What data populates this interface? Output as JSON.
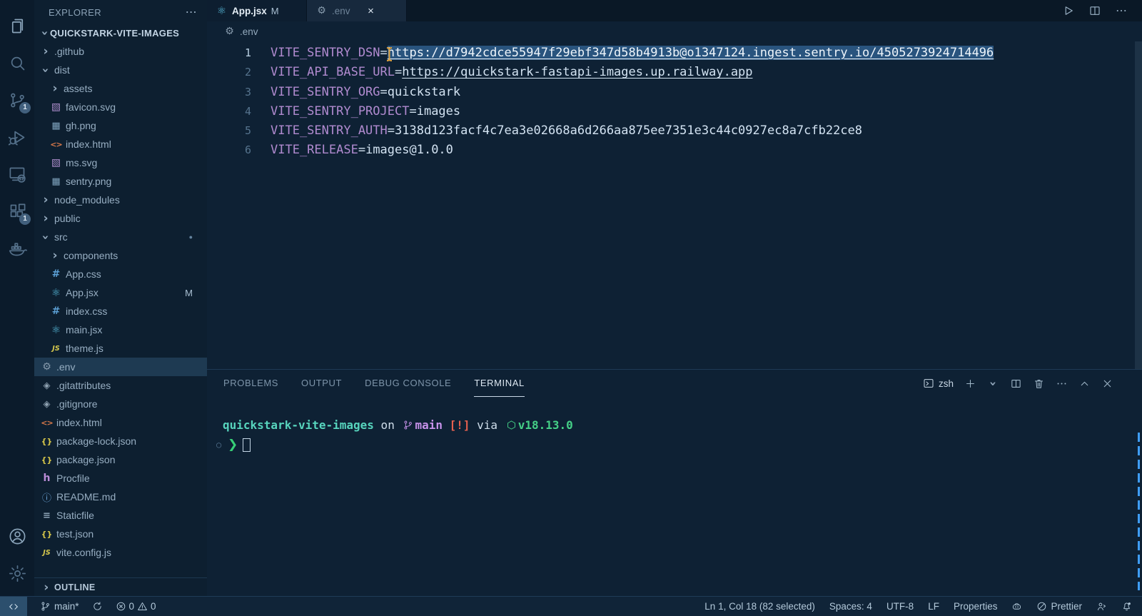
{
  "activity_bar": {
    "items": [
      {
        "name": "explorer",
        "icon": "files-icon"
      },
      {
        "name": "search",
        "icon": "search-icon"
      },
      {
        "name": "source-control",
        "icon": "source-control-icon",
        "badge": "1"
      },
      {
        "name": "run-debug",
        "icon": "run-debug-icon"
      },
      {
        "name": "remote-explorer",
        "icon": "remote-explorer-icon"
      },
      {
        "name": "extensions",
        "icon": "extensions-icon",
        "badge": "1"
      },
      {
        "name": "docker",
        "icon": "docker-icon"
      }
    ],
    "bottom_items": [
      {
        "name": "account",
        "icon": "account-icon"
      },
      {
        "name": "settings",
        "icon": "gear-icon"
      }
    ]
  },
  "sidebar": {
    "title": "EXPLORER",
    "section": "QUICKSTARK-VITE-IMAGES",
    "outline_label": "OUTLINE",
    "tree": [
      {
        "label": ".github",
        "indent": 1,
        "icon": "chevron-right-icon"
      },
      {
        "label": "dist",
        "indent": 1,
        "icon": "chevron-down-icon"
      },
      {
        "label": "assets",
        "indent": 2,
        "icon": "chevron-right-icon"
      },
      {
        "label": "favicon.svg",
        "indent": 2,
        "icon": "svg-file-icon"
      },
      {
        "label": "gh.png",
        "indent": 2,
        "icon": "image-file-icon"
      },
      {
        "label": "index.html",
        "indent": 2,
        "icon": "html-file-icon"
      },
      {
        "label": "ms.svg",
        "indent": 2,
        "icon": "svg-file-icon"
      },
      {
        "label": "sentry.png",
        "indent": 2,
        "icon": "image-file-icon"
      },
      {
        "label": "node_modules",
        "indent": 1,
        "icon": "chevron-right-icon"
      },
      {
        "label": "public",
        "indent": 1,
        "icon": "chevron-right-icon"
      },
      {
        "label": "src",
        "indent": 1,
        "icon": "chevron-down-icon",
        "dot": true
      },
      {
        "label": "components",
        "indent": 2,
        "icon": "chevron-right-icon"
      },
      {
        "label": "App.css",
        "indent": 2,
        "icon": "css-file-icon"
      },
      {
        "label": "App.jsx",
        "indent": 2,
        "icon": "react-file-icon",
        "badge": "M"
      },
      {
        "label": "index.css",
        "indent": 2,
        "icon": "css-file-icon"
      },
      {
        "label": "main.jsx",
        "indent": 2,
        "icon": "react-file-icon"
      },
      {
        "label": "theme.js",
        "indent": 2,
        "icon": "js-file-icon"
      },
      {
        "label": ".env",
        "indent": 1,
        "icon": "gear-file-icon",
        "selected": true
      },
      {
        "label": ".gitattributes",
        "indent": 1,
        "icon": "git-file-icon"
      },
      {
        "label": ".gitignore",
        "indent": 1,
        "icon": "git-file-icon"
      },
      {
        "label": "index.html",
        "indent": 1,
        "icon": "html-file-icon"
      },
      {
        "label": "package-lock.json",
        "indent": 1,
        "icon": "json-file-icon"
      },
      {
        "label": "package.json",
        "indent": 1,
        "icon": "json-file-icon"
      },
      {
        "label": "Procfile",
        "indent": 1,
        "icon": "heroku-file-icon"
      },
      {
        "label": "README.md",
        "indent": 1,
        "icon": "info-file-icon"
      },
      {
        "label": "Staticfile",
        "indent": 1,
        "icon": "text-file-icon"
      },
      {
        "label": "test.json",
        "indent": 1,
        "icon": "json-file-icon"
      },
      {
        "label": "vite.config.js",
        "indent": 1,
        "icon": "js-file-icon"
      }
    ]
  },
  "editor": {
    "tabs": [
      {
        "label": "App.jsx",
        "icon": "react-file-icon",
        "badge": "M",
        "active": false
      },
      {
        "label": ".env",
        "icon": "gear-file-icon",
        "active": true,
        "close": true
      }
    ],
    "actions": [
      {
        "name": "run",
        "icon": "play-icon"
      },
      {
        "name": "split-editor",
        "icon": "split-icon"
      },
      {
        "name": "more-actions",
        "icon": "ellipsis-icon"
      }
    ],
    "breadcrumb": {
      "icon": "gear-file-icon",
      "label": ".env"
    },
    "lines": [
      {
        "num": "1",
        "key": "VITE_SENTRY_DSN",
        "value": "https://d7942cdce55947f29ebf347d58b4913b@o1347124.ingest.sentry.io/4505273924714496",
        "link": true,
        "selected": true,
        "active": true
      },
      {
        "num": "2",
        "key": "VITE_API_BASE_URL",
        "value": "https://quickstark-fastapi-images.up.railway.app",
        "link": true
      },
      {
        "num": "3",
        "key": "VITE_SENTRY_ORG",
        "value": "quickstark"
      },
      {
        "num": "4",
        "key": "VITE_SENTRY_PROJECT",
        "value": "images"
      },
      {
        "num": "5",
        "key": "VITE_SENTRY_AUTH",
        "value": "3138d123facf4c7ea3e02668a6d266aa875ee7351e3c44c0927ec8a7cfb22ce8"
      },
      {
        "num": "6",
        "key": "VITE_RELEASE",
        "value": "images@1.0.0"
      }
    ]
  },
  "panel": {
    "tabs": [
      {
        "label": "PROBLEMS"
      },
      {
        "label": "OUTPUT"
      },
      {
        "label": "DEBUG CONSOLE"
      },
      {
        "label": "TERMINAL",
        "active": true
      }
    ],
    "shell_label": "zsh",
    "actions": [
      {
        "name": "new-terminal",
        "icon": "plus-icon"
      },
      {
        "name": "terminal-dropdown",
        "icon": "chevron-down-icon"
      },
      {
        "name": "split-terminal",
        "icon": "split-icon"
      },
      {
        "name": "kill-terminal",
        "icon": "trash-icon"
      },
      {
        "name": "more-actions",
        "icon": "ellipsis-icon"
      },
      {
        "name": "maximize-panel",
        "icon": "chevron-up-icon"
      },
      {
        "name": "close-panel",
        "icon": "close-icon"
      }
    ],
    "terminal": {
      "prompt_segments": [
        {
          "text": "quickstark-vite-images",
          "style": "dir"
        },
        {
          "text": " on ",
          "style": "plain"
        },
        {
          "icon": "branch-icon",
          "style": "branch"
        },
        {
          "text": "main",
          "style": "branch"
        },
        {
          "text": " [!]",
          "style": "alert"
        },
        {
          "text": " via ",
          "style": "plain"
        },
        {
          "icon": "node-icon",
          "style": "node"
        },
        {
          "text": "v18.13.0",
          "style": "node"
        }
      ],
      "job_indicator": "○",
      "prompt_char": "❯"
    }
  },
  "status_bar": {
    "left": [
      {
        "name": "remote",
        "icon": "remote-icon"
      },
      {
        "name": "branch",
        "icon": "branch-icon",
        "label": "main*"
      },
      {
        "name": "sync",
        "icon": "sync-icon"
      },
      {
        "name": "problems",
        "parts": [
          {
            "icon": "error-icon",
            "label": "0"
          },
          {
            "icon": "warning-icon",
            "label": "0"
          }
        ]
      }
    ],
    "right": [
      {
        "name": "cursor-position",
        "label": "Ln 1, Col 18 (82 selected)"
      },
      {
        "name": "indentation",
        "label": "Spaces: 4"
      },
      {
        "name": "encoding",
        "label": "UTF-8"
      },
      {
        "name": "eol",
        "label": "LF"
      },
      {
        "name": "language-mode",
        "label": "Properties"
      },
      {
        "name": "copilot",
        "icon": "copilot-icon"
      },
      {
        "name": "formatter",
        "icon": "prettier-icon",
        "label": "Prettier"
      },
      {
        "name": "feedback",
        "icon": "feedback-icon"
      },
      {
        "name": "notifications",
        "icon": "bell-icon"
      }
    ]
  }
}
